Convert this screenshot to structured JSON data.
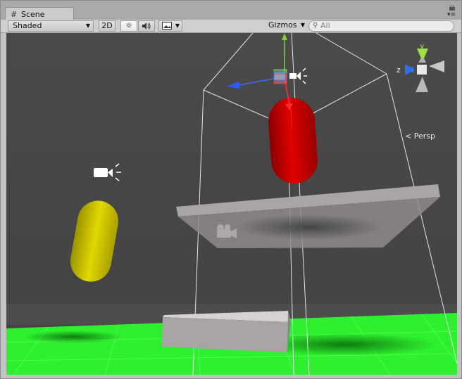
{
  "window": {
    "tab_icon": "#",
    "tab_title": "Scene",
    "lock_icon": "lock-icon",
    "menu_icon": "▾≡"
  },
  "toolbar": {
    "draw_mode": "Shaded",
    "dropdown_arrow": "▼",
    "mode_2d": "2D",
    "lighting_icon": "☼",
    "audio_icon": "🔊",
    "effects_icon": "▣",
    "gizmos_label": "Gizmos",
    "search_placeholder": "All",
    "search_icon": "⚲"
  },
  "orientation_gizmo": {
    "y_label": "y",
    "z_label": "z",
    "projection_label": "Persp",
    "projection_icon": "<"
  },
  "colors": {
    "ground": "#28f028",
    "sky": "#474747",
    "red_object": "#d40000",
    "yellow_object": "#dcd200",
    "platform": "#9e9a9a"
  }
}
